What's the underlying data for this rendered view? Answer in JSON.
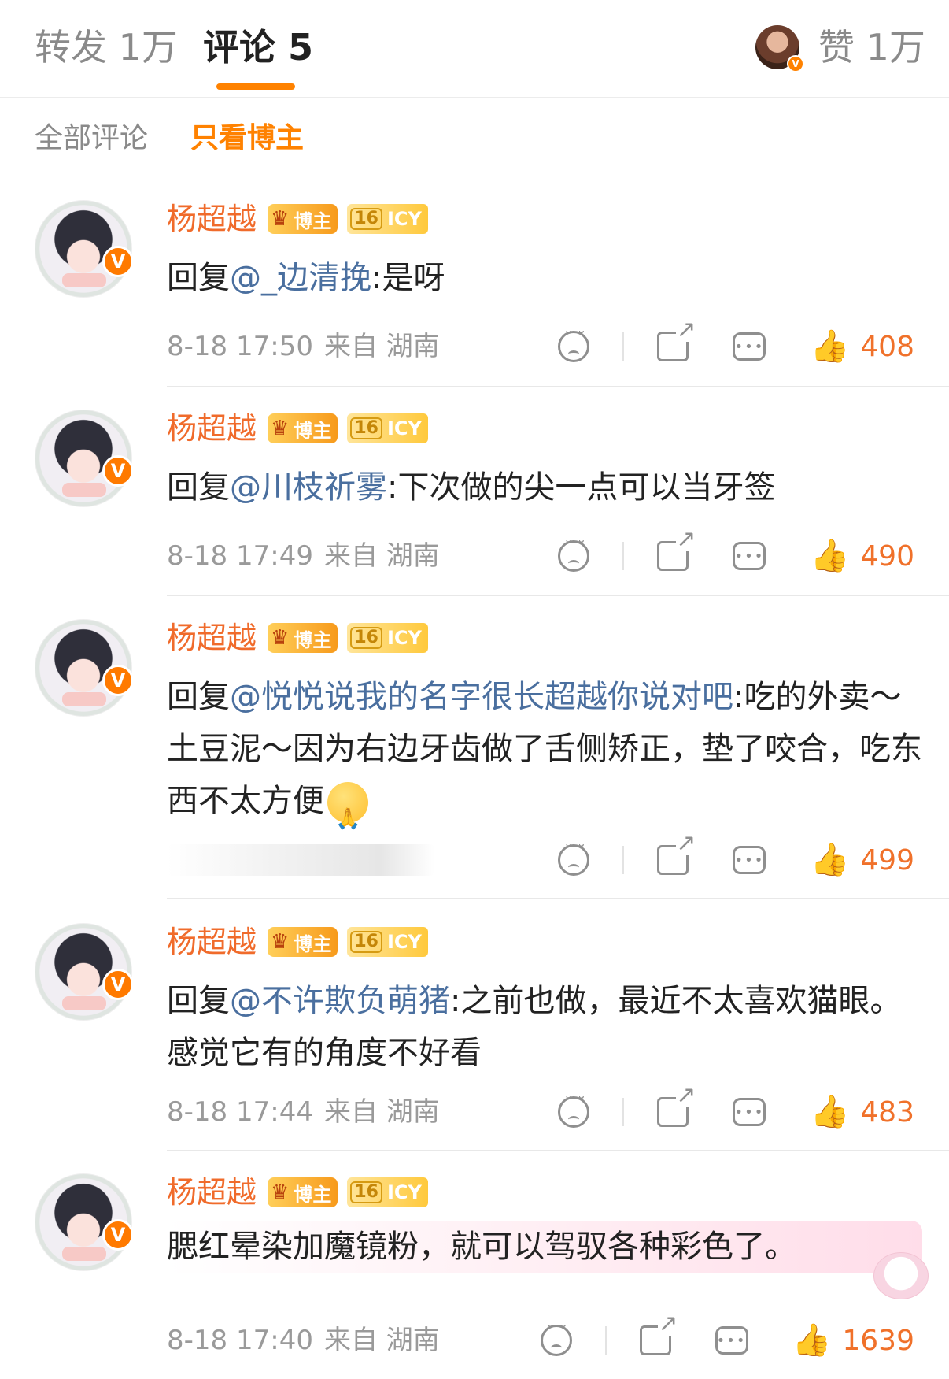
{
  "tabs": {
    "repost": "转发 1万",
    "comments": "评论 5",
    "likes": "赞 1万"
  },
  "filters": {
    "all": "全部评论",
    "op_only": "只看博主"
  },
  "badges": {
    "op": "博主",
    "level": "16",
    "icy": "ICY",
    "verified": "V"
  },
  "colors": {
    "accent": "#ff8200",
    "username": "#f06b2b",
    "mention": "#4a6f9f",
    "muted": "#9a9a9a"
  },
  "icons": {
    "emoji_reaction": "sad-face-icon",
    "share": "share-icon",
    "reply": "comment-bubble-icon",
    "like": "thumbs-up-icon",
    "inline_emoji": "pray-emoji-icon"
  },
  "comments": [
    {
      "username": "杨超越",
      "prefix": "回复",
      "mention": "@_边清挽",
      "text": ":是呀",
      "date": "8-18 17:50",
      "source": "来自 湖南",
      "likes": "408"
    },
    {
      "username": "杨超越",
      "prefix": "回复",
      "mention": "@川枝祈雾",
      "text": ":下次做的尖一点可以当牙签",
      "date": "8-18 17:49",
      "source": "来自 湖南",
      "likes": "490"
    },
    {
      "username": "杨超越",
      "prefix": "回复",
      "mention": "@悦悦说我的名字很长超越你说对吧",
      "text": ":吃的外卖～土豆泥～因为右边牙齿做了舌侧矫正，垫了咬合，吃东西不太方便",
      "likes": "499"
    },
    {
      "username": "杨超越",
      "prefix": "回复",
      "mention": "@不许欺负萌猪",
      "text": ":之前也做，最近不太喜欢猫眼。感觉它有的角度不好看",
      "date": "8-18 17:44",
      "source": "来自 湖南",
      "likes": "483"
    },
    {
      "username": "杨超越",
      "text": "腮红晕染加魔镜粉，就可以驾驭各种彩色了。",
      "date": "8-18 17:40",
      "source": "来自 湖南",
      "likes": "1639"
    }
  ]
}
